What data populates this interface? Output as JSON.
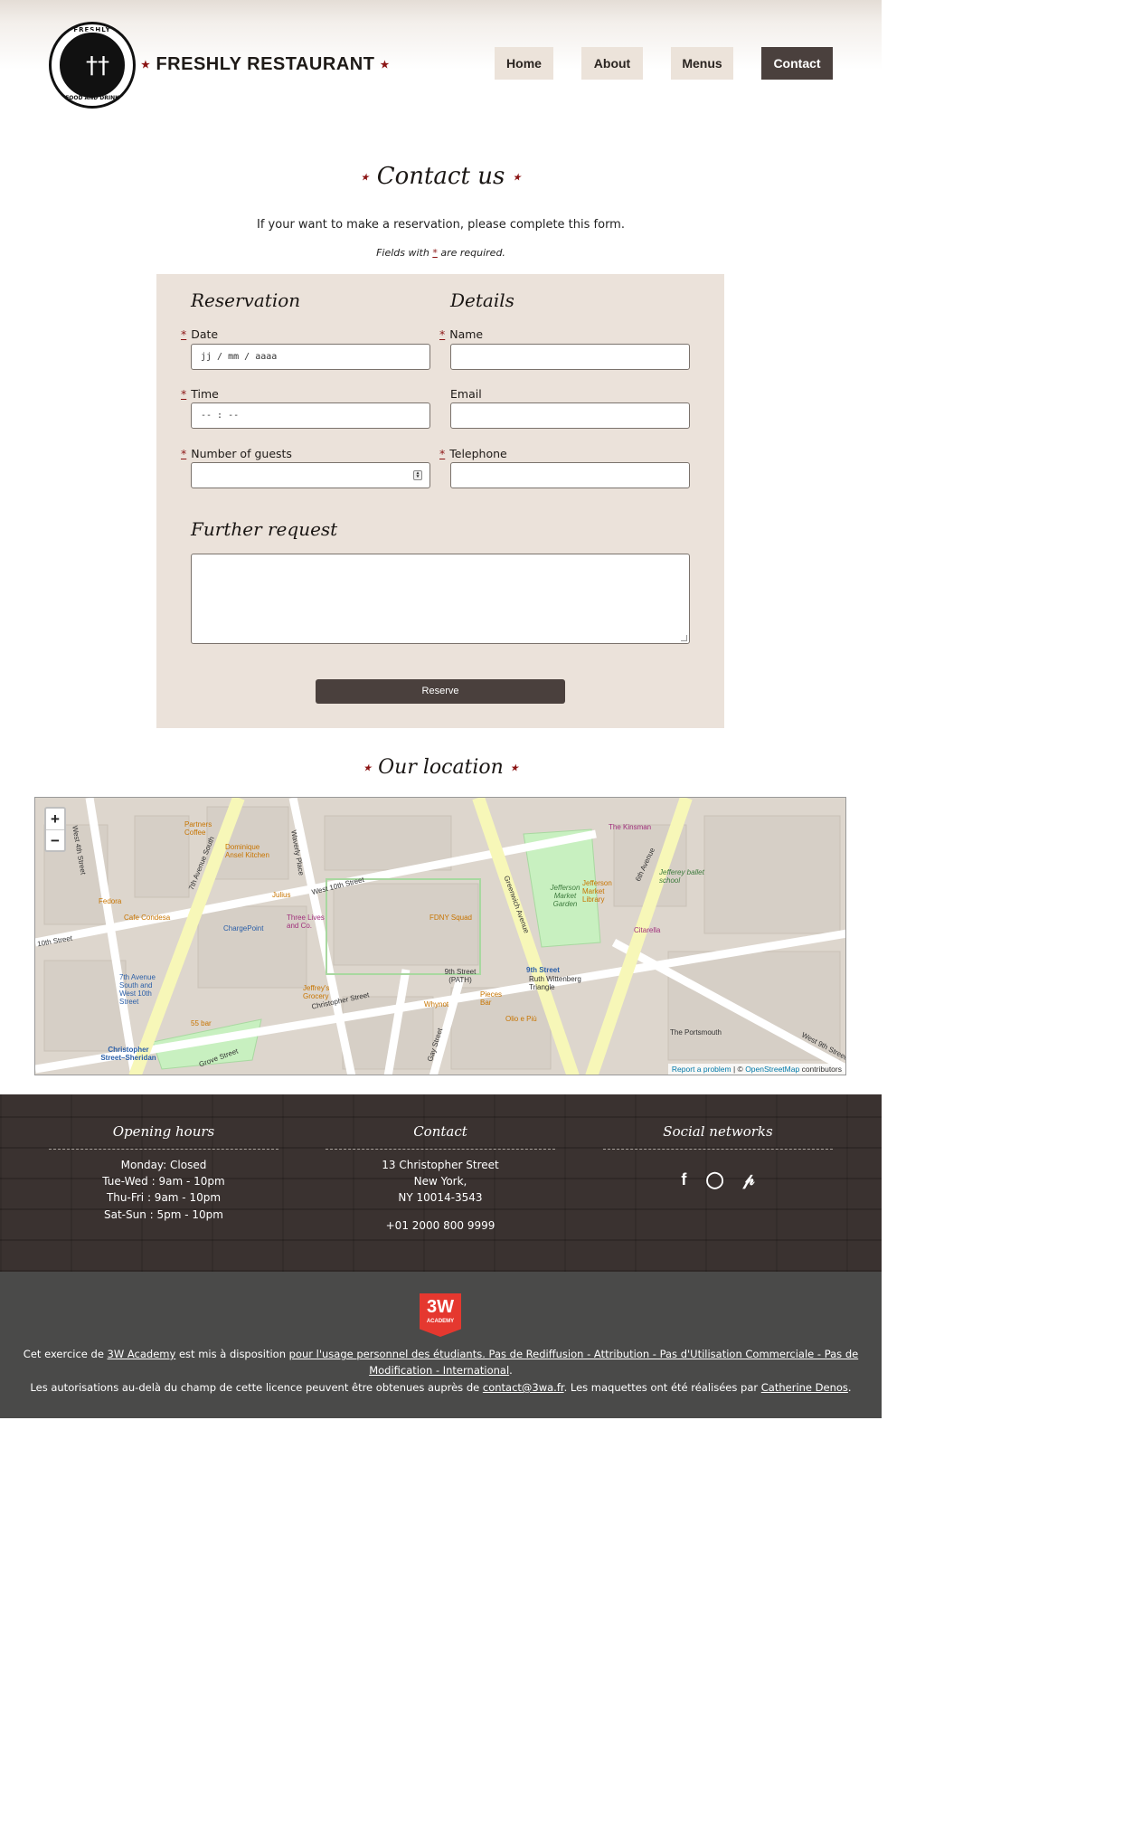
{
  "header": {
    "logo": {
      "top_text": "FRESHLY",
      "bottom_text": "FOOD AND DRINK"
    },
    "brand": "FRESHLY RESTAURANT",
    "nav": [
      {
        "label": "Home",
        "active": false
      },
      {
        "label": "About",
        "active": false
      },
      {
        "label": "Menus",
        "active": false
      },
      {
        "label": "Contact",
        "active": true
      }
    ]
  },
  "contact": {
    "title": "Contact us",
    "intro": "If your want to make a reservation, please complete this form.",
    "required_note_prefix": "Fields with",
    "required_note_star": "*",
    "required_note_suffix": "are required."
  },
  "form": {
    "reservation_title": "Reservation",
    "details_title": "Details",
    "date_label": "Date",
    "date_placeholder": "jj / mm / aaaa",
    "time_label": "Time",
    "time_placeholder": "-- : --",
    "guests_label": "Number of guests",
    "name_label": "Name",
    "email_label": "Email",
    "telephone_label": "Telephone",
    "further_title": "Further request",
    "reserve_label": "Reserve"
  },
  "location": {
    "title": "Our location",
    "zoom_in": "+",
    "zoom_out": "−",
    "attribution_report": "Report a problem",
    "attribution_sep": "| ©",
    "attribution_osm": "OpenStreetMap",
    "attribution_contrib": "contributors",
    "labels": [
      "West 4th Street",
      "7th Avenue South",
      "Waverly Place",
      "West 10th Street",
      "Greenwich Avenue",
      "6th Avenue",
      "Christopher Street",
      "Grove Street",
      "Gay Street",
      "9th Street (PATH)",
      "9th Street",
      "Ruth Wittenberg Triangle",
      "Jefferson Market Garden",
      "Jefferson Market Library",
      "FDNY Squad",
      "ChargePoint",
      "Three Lives and Co.",
      "Partners Coffee",
      "Dominique Ansel Kitchen",
      "Fedora",
      "Cafe Condesa",
      "Julius",
      "Jeffrey's Grocery",
      "Whynot",
      "Pieces Bar",
      "Olio e Più",
      "55 bar",
      "The Portsmouth",
      "Citarella",
      "The Kinsman",
      "Jefferey ballet school",
      "7th Avenue South and West 10th Street",
      "Christopher Street–Sheridan",
      "West 9th Street",
      "10th Street"
    ]
  },
  "footer": {
    "hours_title": "Opening hours",
    "hours": [
      "Monday: Closed",
      "Tue-Wed : 9am - 10pm",
      "Thu-Fri : 9am - 10pm",
      "Sat-Sun : 5pm - 10pm"
    ],
    "contact_title": "Contact",
    "address": [
      "13 Christopher Street",
      "New York,",
      "NY 10014-3543"
    ],
    "phone": "+01 2000 800 9999",
    "social_title": "Social networks",
    "social_icons": [
      "facebook-icon",
      "instagram-icon",
      "pinterest-icon"
    ]
  },
  "legal": {
    "badge_top": "3W",
    "badge_bottom": "ACADEMY",
    "l1_a": "Cet exercice de ",
    "l1_link1": "3W Academy",
    "l1_b": " est mis à disposition ",
    "l1_link2": "pour l'usage personnel des étudiants. Pas de Rediffusion - Attribution - Pas d'Utilisation Commerciale - Pas de Modification - International",
    "l1_c": ".",
    "l2_a": "Les autorisations au-delà du champ de cette licence peuvent être obtenues auprès de ",
    "l2_link1": "contact@3wa.fr",
    "l2_b": ". Les maquettes ont été réalisées par ",
    "l2_link2": "Catherine Denos",
    "l2_c": "."
  },
  "colors": {
    "accent_dark": "#4a403d",
    "form_bg": "#ebe2da",
    "required_star": "#8b1414",
    "footer_bg": "#3a3230",
    "bottom_bg": "#4a4a49",
    "badge_red": "#e5382f"
  }
}
